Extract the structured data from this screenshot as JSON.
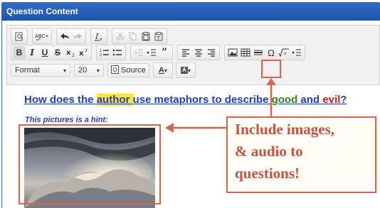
{
  "panel": {
    "title": "Question Content"
  },
  "toolbar": {
    "row1": [
      {
        "name": "preview-icon"
      },
      {
        "name": "spellcheck-icon"
      },
      {
        "name": "undo-icon"
      },
      {
        "name": "redo-icon"
      },
      {
        "name": "remove-format-icon"
      },
      {
        "name": "cut-icon"
      },
      {
        "name": "copy-icon"
      },
      {
        "name": "paste-icon"
      },
      {
        "name": "paste-text-icon"
      }
    ],
    "format_combo": "Format",
    "size_combo": "20",
    "source_label": "Source"
  },
  "content": {
    "question": {
      "part1": "How does the ",
      "author": "author ",
      "part2": "use metaphors to describe ",
      "good": "good",
      "and": " and ",
      "evil": "evil",
      "qmark": "?"
    },
    "hint": "This pictures is a hint:"
  },
  "callout": {
    "line1": "Include images,",
    "line2": "& audio to",
    "line3": "questions!"
  },
  "colors": {
    "header": "#2f6bc8",
    "annotation": "#e0614a",
    "question_text": "#1f3fbf",
    "highlight": "#ffe53b",
    "good": "#2a8a19",
    "evil": "#d81d1d"
  }
}
